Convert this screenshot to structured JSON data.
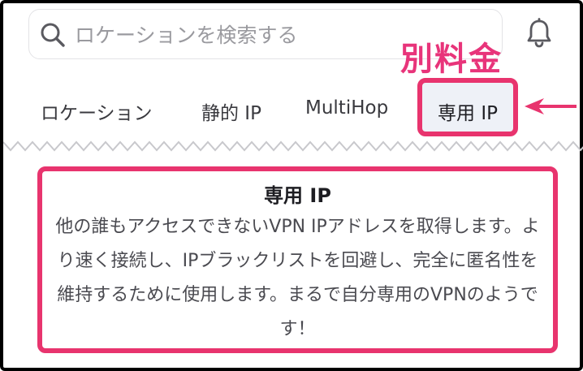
{
  "search": {
    "placeholder": "ロケーションを検索する",
    "icon": "search-icon"
  },
  "header": {
    "notification_icon": "bell-icon"
  },
  "annotation": {
    "price_label": "別料金",
    "color": "#e8347a"
  },
  "tabs": [
    {
      "label": "ロケーション",
      "selected": false
    },
    {
      "label": "静的 IP",
      "selected": false
    },
    {
      "label": "MultiHop",
      "selected": false
    },
    {
      "label": "専用 IP",
      "selected": true
    }
  ],
  "panel": {
    "title": "専用 IP",
    "description": "他の誰もアクセスできないVPN IPアドレスを取得します。より速く接続し、IPブラックリストを回避し、完全に匿名性を維持するために使用します。まるで自分専用のVPNのようです！"
  },
  "colors": {
    "highlight": "#e8346e",
    "text": "#3a3a3f",
    "muted": "#9a9a9f"
  }
}
